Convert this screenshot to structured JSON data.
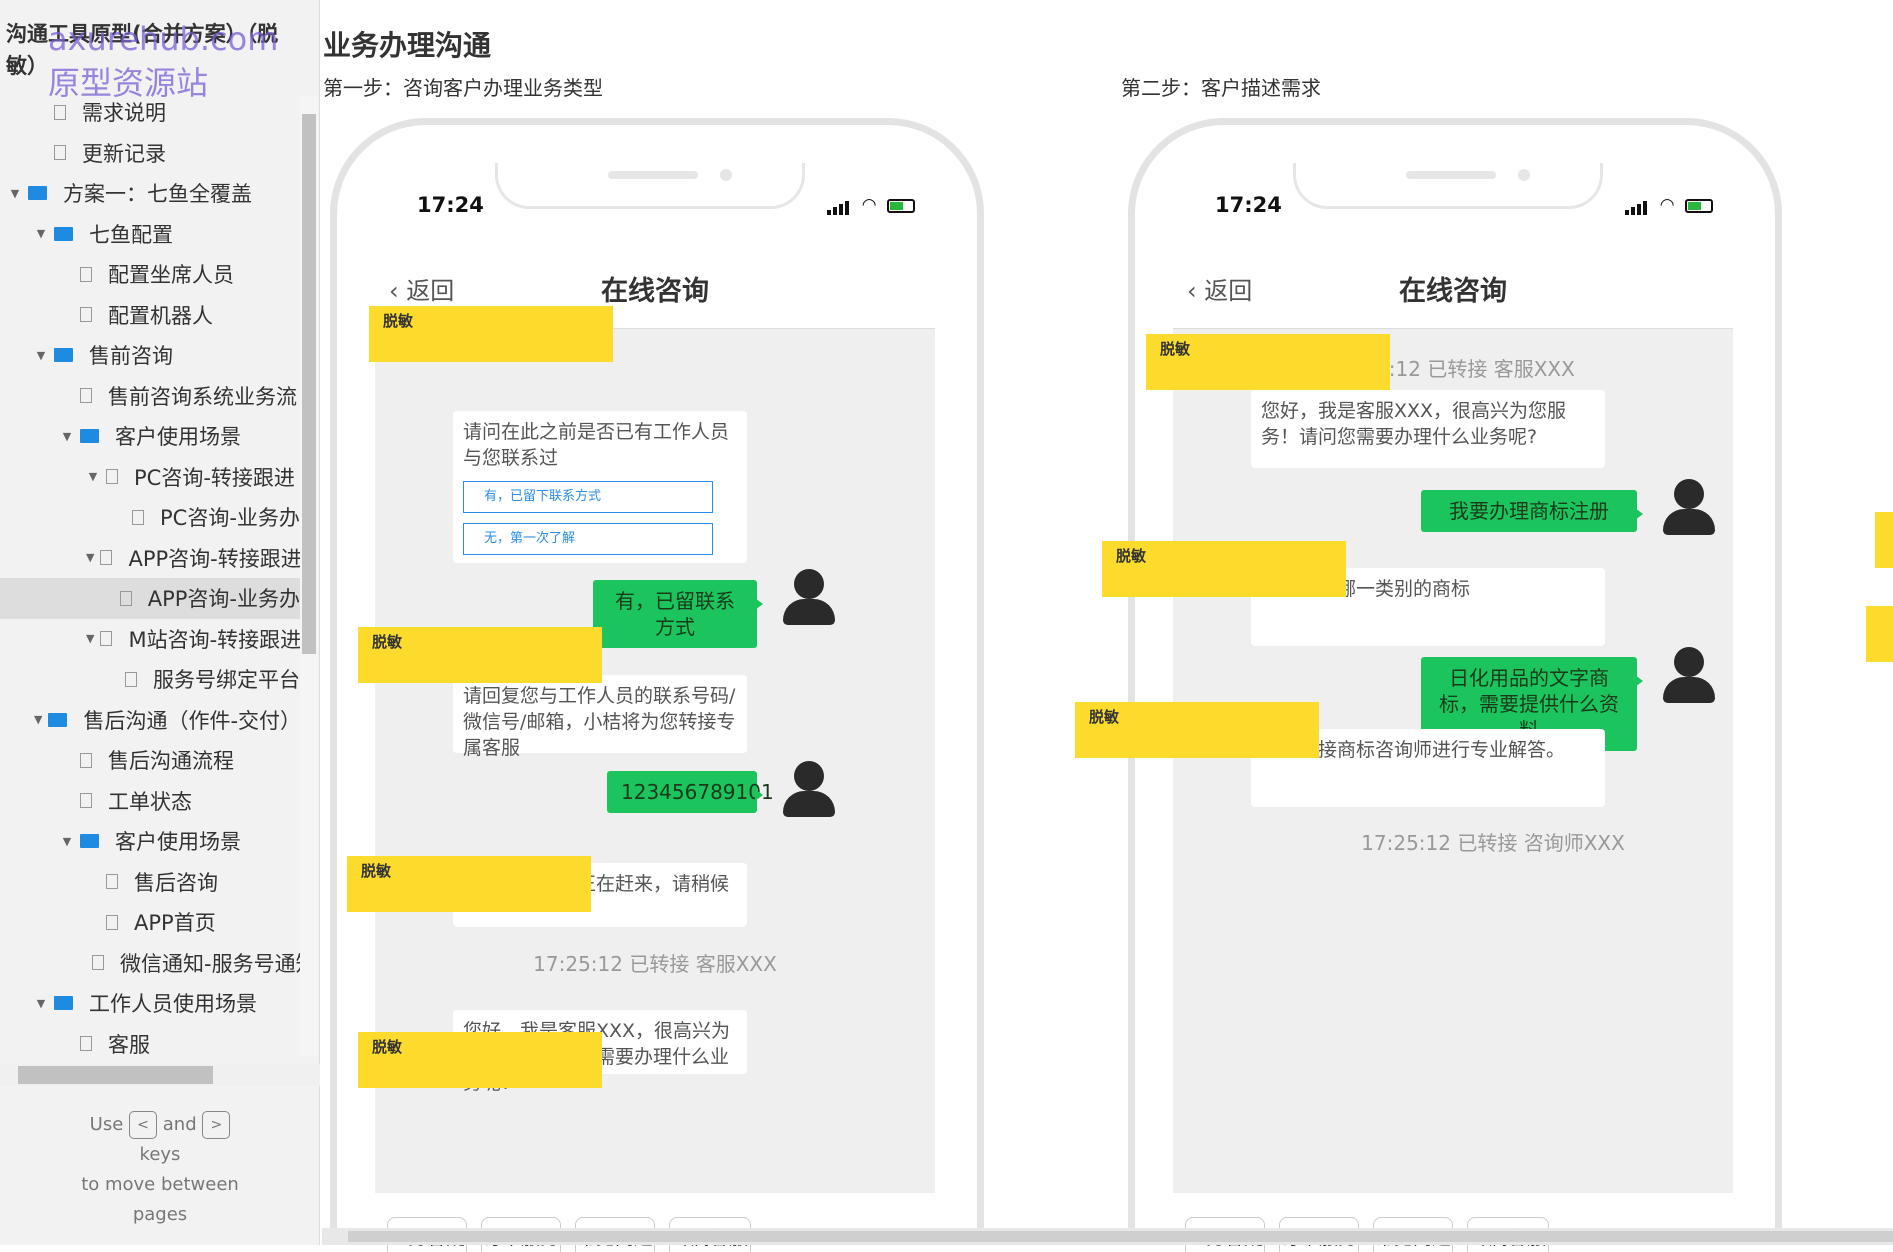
{
  "sidebar": {
    "title": "沟通工具原型(合并方案）（脱敏）",
    "watermark": "axurehub.com 原型资源站",
    "items": [
      {
        "label": "需求说明",
        "level": 1,
        "icon": "page-icon",
        "arrow": ""
      },
      {
        "label": "更新记录",
        "level": 1,
        "icon": "page-icon",
        "arrow": ""
      },
      {
        "label": "方案一：七鱼全覆盖",
        "level": 0,
        "icon": "folder-icon",
        "arrow": "▼"
      },
      {
        "label": "七鱼配置",
        "level": 1,
        "icon": "folder-icon",
        "arrow": "▼"
      },
      {
        "label": "配置坐席人员",
        "level": 2,
        "icon": "page-icon",
        "arrow": ""
      },
      {
        "label": "配置机器人",
        "level": 2,
        "icon": "page-icon",
        "arrow": ""
      },
      {
        "label": "售前咨询",
        "level": 1,
        "icon": "folder-icon",
        "arrow": "▼"
      },
      {
        "label": "售前咨询系统业务流",
        "level": 2,
        "icon": "page-icon",
        "arrow": ""
      },
      {
        "label": "客户使用场景",
        "level": 2,
        "icon": "folder-icon",
        "arrow": "▼"
      },
      {
        "label": "PC咨询-转接跟进",
        "level": 3,
        "icon": "page-icon",
        "arrow": "▼"
      },
      {
        "label": "PC咨询-业务办",
        "level": 4,
        "icon": "page-icon",
        "arrow": ""
      },
      {
        "label": "APP咨询-转接跟进",
        "level": 3,
        "icon": "page-icon",
        "arrow": "▼"
      },
      {
        "label": "APP咨询-业务办",
        "level": 4,
        "icon": "page-icon",
        "arrow": "",
        "selected": true
      },
      {
        "label": "M站咨询-转接跟进",
        "level": 3,
        "icon": "page-icon",
        "arrow": "▼"
      },
      {
        "label": "服务号绑定平台",
        "level": 4,
        "icon": "page-icon",
        "arrow": ""
      },
      {
        "label": "售后沟通（作件-交付）",
        "level": 1,
        "icon": "folder-icon",
        "arrow": "▼"
      },
      {
        "label": "售后沟通流程",
        "level": 2,
        "icon": "page-icon",
        "arrow": ""
      },
      {
        "label": "工单状态",
        "level": 2,
        "icon": "page-icon",
        "arrow": ""
      },
      {
        "label": "客户使用场景",
        "level": 2,
        "icon": "folder-icon",
        "arrow": "▼"
      },
      {
        "label": "售后咨询",
        "level": 3,
        "icon": "page-icon",
        "arrow": ""
      },
      {
        "label": "APP首页",
        "level": 3,
        "icon": "page-icon",
        "arrow": ""
      },
      {
        "label": "微信通知-服务号通知",
        "level": 3,
        "icon": "page-icon",
        "arrow": ""
      },
      {
        "label": "工作人员使用场景",
        "level": 1,
        "icon": "folder-icon",
        "arrow": "▼"
      },
      {
        "label": "客服",
        "level": 2,
        "icon": "page-icon",
        "arrow": ""
      }
    ],
    "hint": {
      "use": "Use",
      "and": "and",
      "keys": "keys",
      "move": "to move between",
      "pages": "pages",
      "key_left": "<",
      "key_right": ">"
    }
  },
  "page": {
    "heading": "业务办理沟通",
    "step1": "第一步：咨询客户办理业务类型",
    "step2": "第二步：客户描述需求"
  },
  "phone": {
    "time": "17:24",
    "back": "返回",
    "title": "在线咨询",
    "redacted": "脱敏",
    "quick": [
      "业务答疑",
      "订单服务",
      "常见问题",
      "专属客服"
    ]
  },
  "chat1": {
    "q1": "请问在此之前是否已有工作人员与您联系过",
    "opt1": "有，已留下联系方式",
    "opt2": "无，第一次了解",
    "u1": "有，已留联系方式",
    "q2": "请回复您与工作人员的联系号码/微信号/邮箱，小桔将为您转接专属客服",
    "u2": "123456789101",
    "q3": "您的专属客服正在赶来，请稍候",
    "sys": "17:25:12  已转接 客服XXX",
    "q4": "您好，我是客服XXX，很高兴为您服务！请问您需要办理什么业务呢?"
  },
  "chat2": {
    "sys1": "17:25:12  已转接 客服XXX",
    "q1": "您好，我是客服XXX，很高兴为您服务！请问您需要办理什么业务呢?",
    "u1": "我要办理商标注册",
    "q2": "注册的是哪一类别的商标",
    "u2": "日化用品的文字商标，需要提供什么资料",
    "q3": "为您转接商标咨询师进行专业解答。",
    "sys2": "17:25:12  已转接 咨询师XXX"
  },
  "colors": {
    "accent_green": "#1bc45c",
    "redaction": "#fddb2d",
    "link_blue": "#2a8de6",
    "folder_blue": "#1f8be0"
  }
}
